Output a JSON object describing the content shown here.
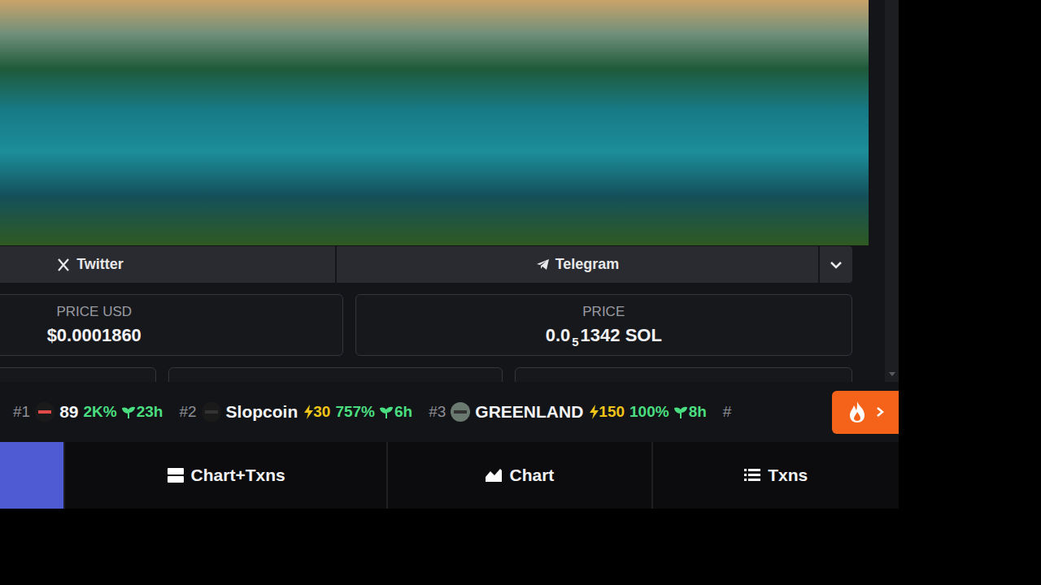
{
  "links": [
    {
      "label": "Twitter"
    },
    {
      "label": "Telegram"
    }
  ],
  "prices": [
    {
      "label": "PRICE USD",
      "value": "$0.0001860"
    },
    {
      "label": "PRICE",
      "value": "0.0",
      "subscript": "5",
      "value_rest": "1342 SOL"
    }
  ],
  "ticker": [
    {
      "rank": "#1",
      "name": "89",
      "boost": "",
      "change": "2K%",
      "age": "23h"
    },
    {
      "rank": "#2",
      "name": "Slopcoin",
      "boost": "30",
      "change": "757%",
      "age": "6h"
    },
    {
      "rank": "#3",
      "name": "GREENLAND",
      "boost": "150",
      "change": "100%",
      "age": "8h"
    }
  ],
  "ticker_more": "#",
  "view_tabs": [
    {
      "label": "Chart+Txns",
      "selected": false
    },
    {
      "label": "Chart",
      "selected": false
    },
    {
      "label": "Txns",
      "selected": false
    }
  ]
}
